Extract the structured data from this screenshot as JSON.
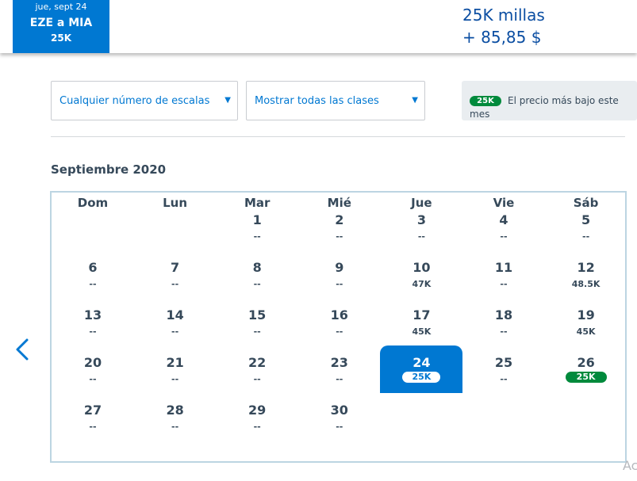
{
  "header": {
    "selected_tab": {
      "date": "jue, sept 24",
      "route": "EZE a MIA",
      "price": "25K"
    },
    "price_miles": "25K millas",
    "price_taxes": "+ 85,85 $"
  },
  "filters": {
    "stops": "Cualquier número de escalas",
    "classes": "Mostrar todas las clases",
    "legend_badge": "25K",
    "legend_text": "El precio más bajo este mes"
  },
  "calendar": {
    "month": "Septiembre 2020",
    "weekdays": [
      "Dom",
      "Lun",
      "Mar",
      "Mié",
      "Jue",
      "Vie",
      "Sáb"
    ],
    "selected_day": "24",
    "days": [
      {
        "day": "1",
        "price": "--"
      },
      {
        "day": "2",
        "price": "--"
      },
      {
        "day": "3",
        "price": "--"
      },
      {
        "day": "4",
        "price": "--"
      },
      {
        "day": "5",
        "price": "--"
      },
      {
        "day": "6",
        "price": "--"
      },
      {
        "day": "7",
        "price": "--"
      },
      {
        "day": "8",
        "price": "--"
      },
      {
        "day": "9",
        "price": "--"
      },
      {
        "day": "10",
        "price": "47K"
      },
      {
        "day": "11",
        "price": "--"
      },
      {
        "day": "12",
        "price": "48.5K"
      },
      {
        "day": "13",
        "price": "--"
      },
      {
        "day": "14",
        "price": "--"
      },
      {
        "day": "15",
        "price": "--"
      },
      {
        "day": "16",
        "price": "--"
      },
      {
        "day": "17",
        "price": "45K"
      },
      {
        "day": "18",
        "price": "--"
      },
      {
        "day": "19",
        "price": "45K"
      },
      {
        "day": "20",
        "price": "--"
      },
      {
        "day": "21",
        "price": "--"
      },
      {
        "day": "22",
        "price": "--"
      },
      {
        "day": "23",
        "price": "--"
      },
      {
        "day": "24",
        "price": "25K"
      },
      {
        "day": "25",
        "price": "--"
      },
      {
        "day": "26",
        "price": "25K"
      },
      {
        "day": "27",
        "price": "--"
      },
      {
        "day": "28",
        "price": "--"
      },
      {
        "day": "29",
        "price": "--"
      },
      {
        "day": "30",
        "price": "--"
      }
    ]
  },
  "watermark": "Ac",
  "colors": {
    "primary": "#0078d2",
    "lowest_price": "#008a3c",
    "text": "#36495a"
  },
  "icons": {
    "prev": "chevron-left-icon",
    "dropdown": "triangle-down-icon"
  }
}
